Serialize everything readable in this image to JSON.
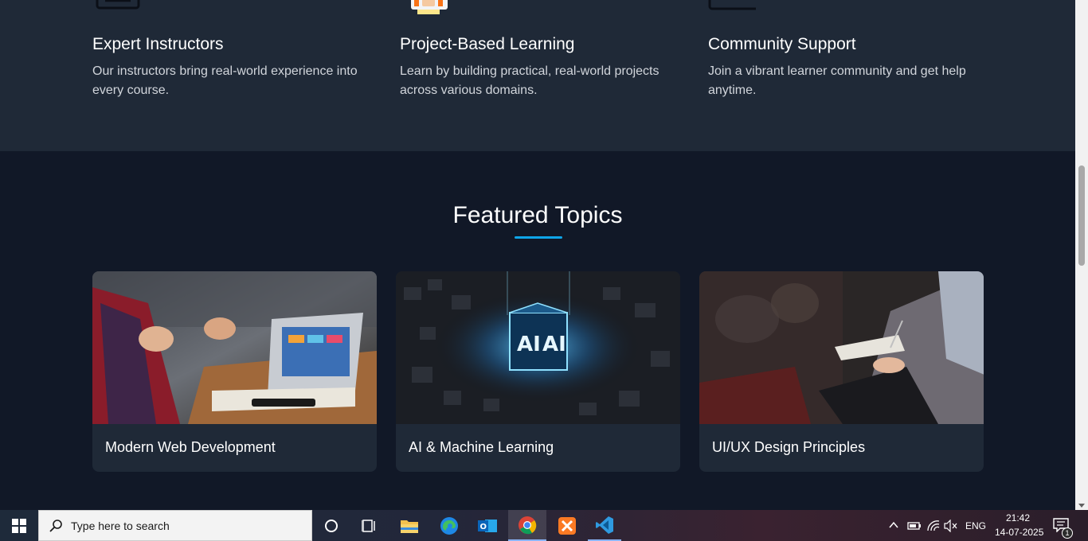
{
  "features": [
    {
      "title": "Expert Instructors",
      "desc": "Our instructors bring real-world experience into every course.",
      "icon": "book-icon"
    },
    {
      "title": "Project-Based Learning",
      "desc": "Learn by building practical, real-world projects across various domains.",
      "icon": "student-avatar-icon"
    },
    {
      "title": "Community Support",
      "desc": "Join a vibrant learner community and get help anytime.",
      "icon": "community-box-icon"
    }
  ],
  "featured": {
    "title": "Featured Topics",
    "cards": [
      {
        "label": "Modern Web Development",
        "image": "laptop-meeting-photo"
      },
      {
        "label": "AI & Machine Learning",
        "image": "ai-cube-photo"
      },
      {
        "label": "UI/UX Design Principles",
        "image": "notes-audience-photo"
      }
    ]
  },
  "taskbar": {
    "search_placeholder": "Type here to search",
    "language": "ENG",
    "time": "21:42",
    "date": "14-07-2025",
    "notification_count": "1",
    "pinned_apps": [
      "cortana-icon",
      "task-view-icon",
      "file-explorer-icon",
      "edge-icon",
      "outlook-icon",
      "chrome-icon",
      "xampp-icon",
      "vscode-icon"
    ]
  },
  "colors": {
    "page_bg": "#111827",
    "section_bg": "#1f2937",
    "accent": "#0ea5e9"
  }
}
